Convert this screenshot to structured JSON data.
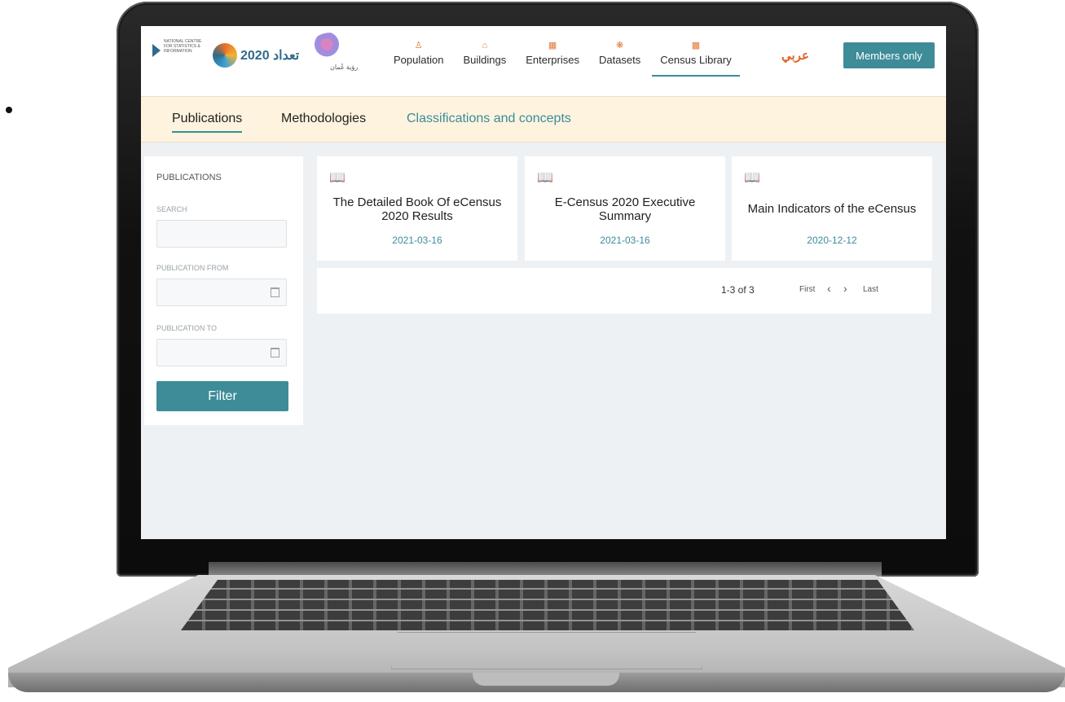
{
  "header": {
    "ncsi_logo_text": "NATIONAL CENTRE FOR STATISTICS & INFORMATION",
    "census_logo_text": "2020 تعداد",
    "vision_logo_text": "رؤية عُمان",
    "nav": [
      {
        "label": "Population",
        "icon": "people-icon"
      },
      {
        "label": "Buildings",
        "icon": "house-icon"
      },
      {
        "label": "Enterprises",
        "icon": "building-icon"
      },
      {
        "label": "Datasets",
        "icon": "dataset-icon"
      },
      {
        "label": "Census Library",
        "icon": "library-icon"
      }
    ],
    "language_link": "عربي",
    "members_label": "Members only"
  },
  "subnav": {
    "tabs": [
      "Publications",
      "Methodologies",
      "Classifications and concepts"
    ]
  },
  "sidebar": {
    "title": "PUBLICATIONS",
    "search_label": "SEARCH",
    "from_label": "PUBLICATION FROM",
    "to_label": "PUBLICATION TO",
    "filter_label": "Filter"
  },
  "cards": [
    {
      "title": "The Detailed Book Of eCensus 2020 Results",
      "date": "2021-03-16"
    },
    {
      "title": "E-Census 2020 Executive Summary",
      "date": "2021-03-16"
    },
    {
      "title": "Main Indicators of the eCensus",
      "date": "2020-12-12"
    }
  ],
  "pagination": {
    "range": "1-3 of 3",
    "first": "First",
    "prev": "‹",
    "next": "›",
    "last": "Last"
  }
}
